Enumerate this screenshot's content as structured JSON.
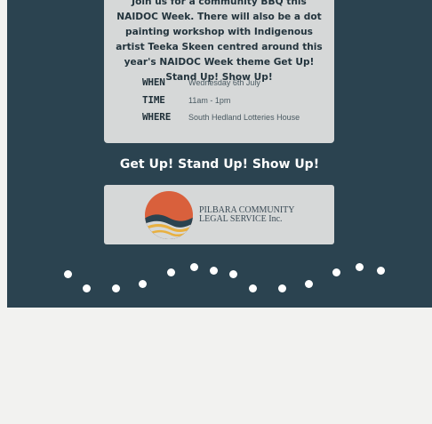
{
  "event": {
    "intro_text": "Join us for a community BBQ this NAIDOC Week. There will also be a dot painting workshop with Indigenous artist Teeka Skeen centred around this year's NAIDOC Week theme Get Up! Stand Up! Show Up!",
    "details": [
      {
        "label": "WHEN",
        "value": "Wednesday 6th July"
      },
      {
        "label": "TIME",
        "value": "11am - 1pm"
      },
      {
        "label": "WHERE",
        "value": "South Hedland Lotteries House"
      }
    ],
    "slogan": "Get Up! Stand Up! Show Up!"
  },
  "logo": {
    "line1": "PILBARA COMMUNITY",
    "line2": "LEGAL SERVICE Inc."
  },
  "colors": {
    "poster_bg": "#2b4350",
    "card_bg": "#d6d8d8",
    "page_bg": "#f2f2f0",
    "logo_orange": "#d9603c",
    "logo_gold": "#e8b040"
  }
}
